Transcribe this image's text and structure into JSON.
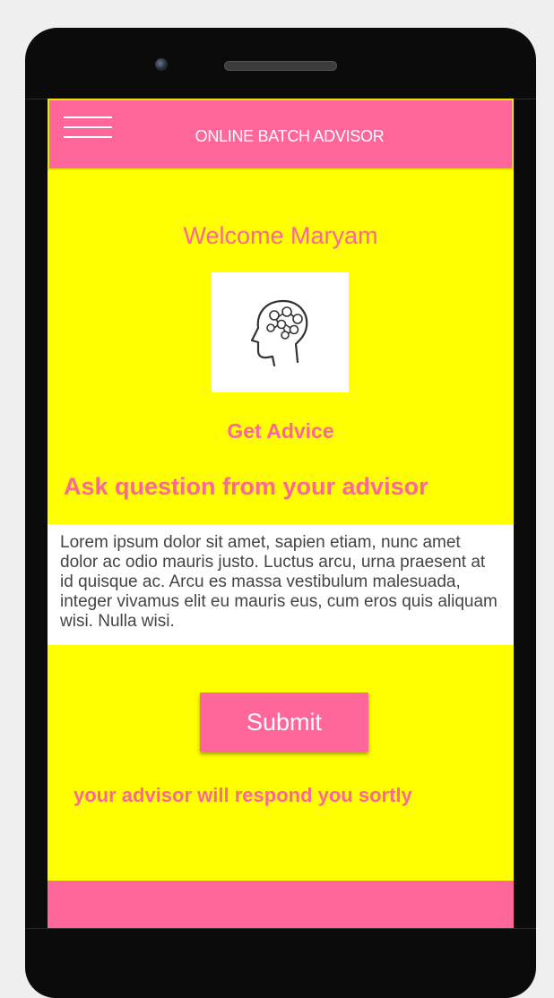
{
  "app": {
    "title": "ONLINE BATCH ADVISOR"
  },
  "header": {
    "menu_icon": "hamburger-menu-icon"
  },
  "main": {
    "welcome_text": "Welcome Maryam",
    "image_icon": "brain-head-icon",
    "get_advice_label": "Get Advice",
    "ask_heading": "Ask question from your advisor",
    "question_value": "Lorem ipsum dolor sit amet, sapien etiam, nunc amet dolor ac odio mauris justo. Luctus arcu, urna praesent at id quisque ac. Arcu es massa vestibulum malesuada, integer vivamus elit eu mauris eus, cum eros quis aliquam wisi. Nulla wisi.",
    "submit_label": "Submit",
    "respond_note": "your advisor will respond you sortly"
  },
  "colors": {
    "accent": "#ff6699",
    "background": "#ffff00",
    "phone_body": "#0b0b0b"
  }
}
